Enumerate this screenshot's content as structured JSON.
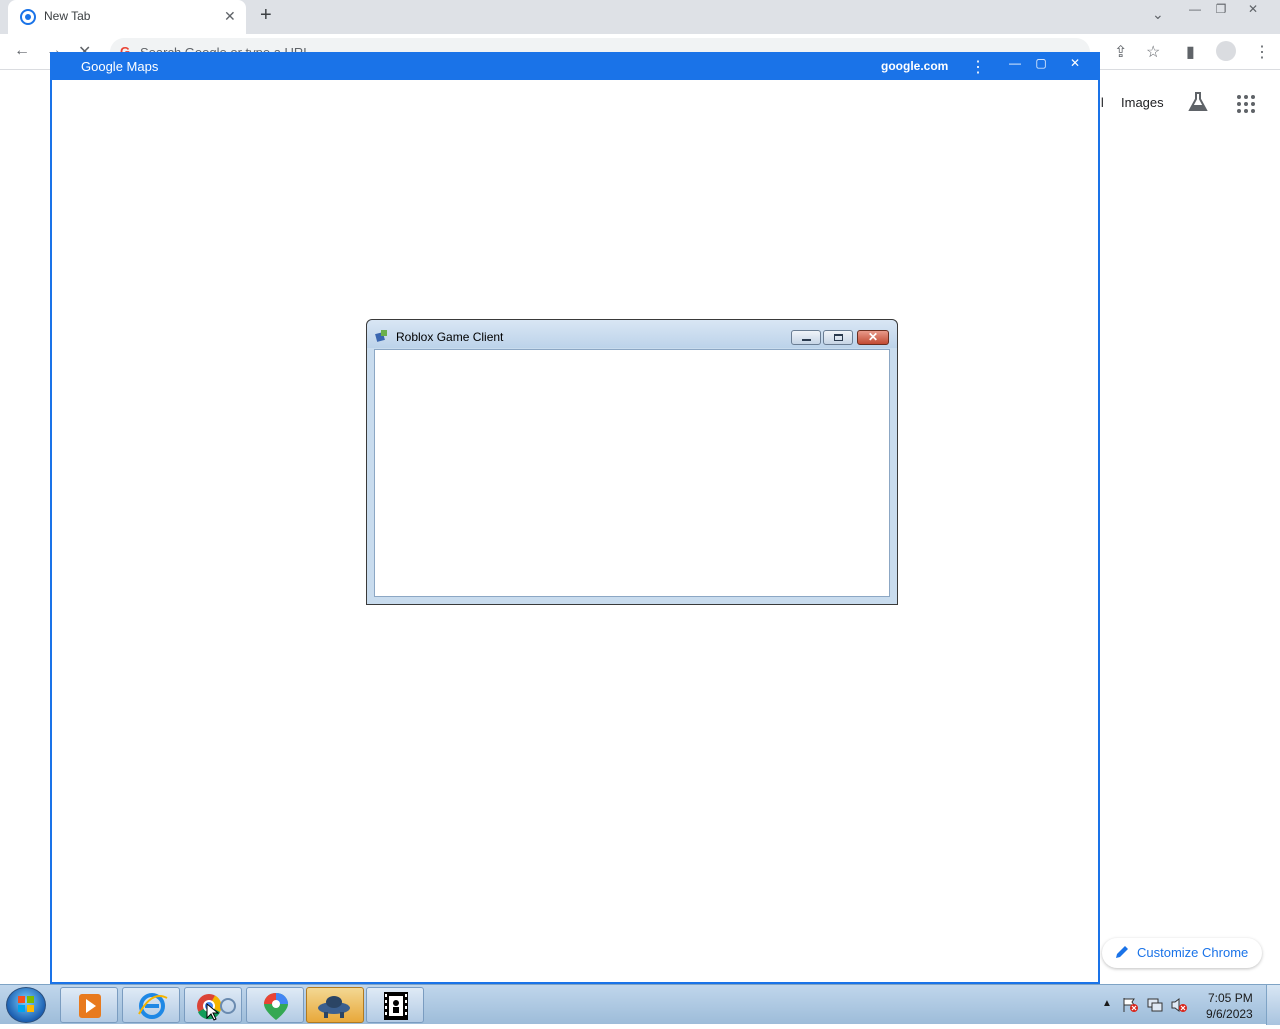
{
  "browser": {
    "tab_title": "New Tab",
    "tab_close_icon": "close-icon",
    "new_tab_icon": "plus-icon",
    "omnibox_text": "Search Google or type a URL"
  },
  "ntp": {
    "gmail_fragment": "il",
    "images_link": "Images",
    "customize_label": "Customize Chrome"
  },
  "maps_window": {
    "title": "Google Maps",
    "domain": "google.com"
  },
  "roblox_window": {
    "title": "Roblox Game Client",
    "close_glyph": "✕"
  },
  "taskbar": {
    "apps": [
      "windows-media-player",
      "internet-explorer",
      "chrome",
      "google-maps",
      "roblox",
      "film-app"
    ],
    "clock_time": "7:05 PM",
    "clock_date": "9/6/2023"
  },
  "colors": {
    "maps_blue": "#1a73e8",
    "roblox_close_red": "#c24a33"
  }
}
